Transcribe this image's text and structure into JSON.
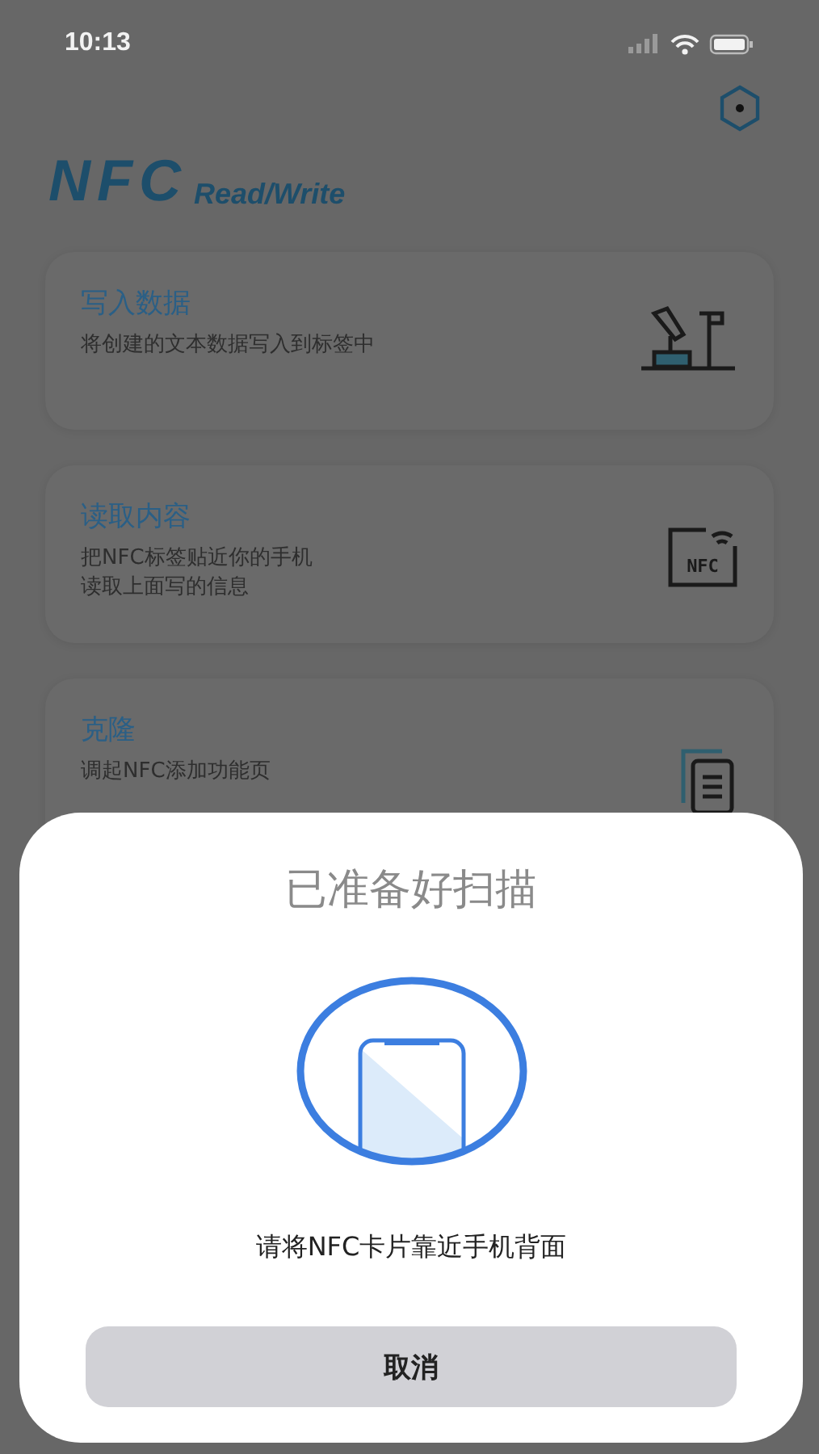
{
  "status_bar": {
    "time": "10:13"
  },
  "logo": {
    "main": "NFC",
    "sub": "Read/Write"
  },
  "cards": [
    {
      "kind": "write",
      "title": "写入数据",
      "lines": [
        "将创建的文本数据写入到标签中"
      ]
    },
    {
      "kind": "read",
      "title": "读取内容",
      "lines": [
        "把NFC标签贴近你的手机",
        "读取上面写的信息"
      ],
      "icon_text": "NFC"
    },
    {
      "kind": "clone",
      "title": "克隆",
      "lines": [
        "调起NFC添加功能页"
      ]
    }
  ],
  "sheet": {
    "title": "已准备好扫描",
    "message": "请将NFC卡片靠近手机背面",
    "cancel": "取消"
  }
}
